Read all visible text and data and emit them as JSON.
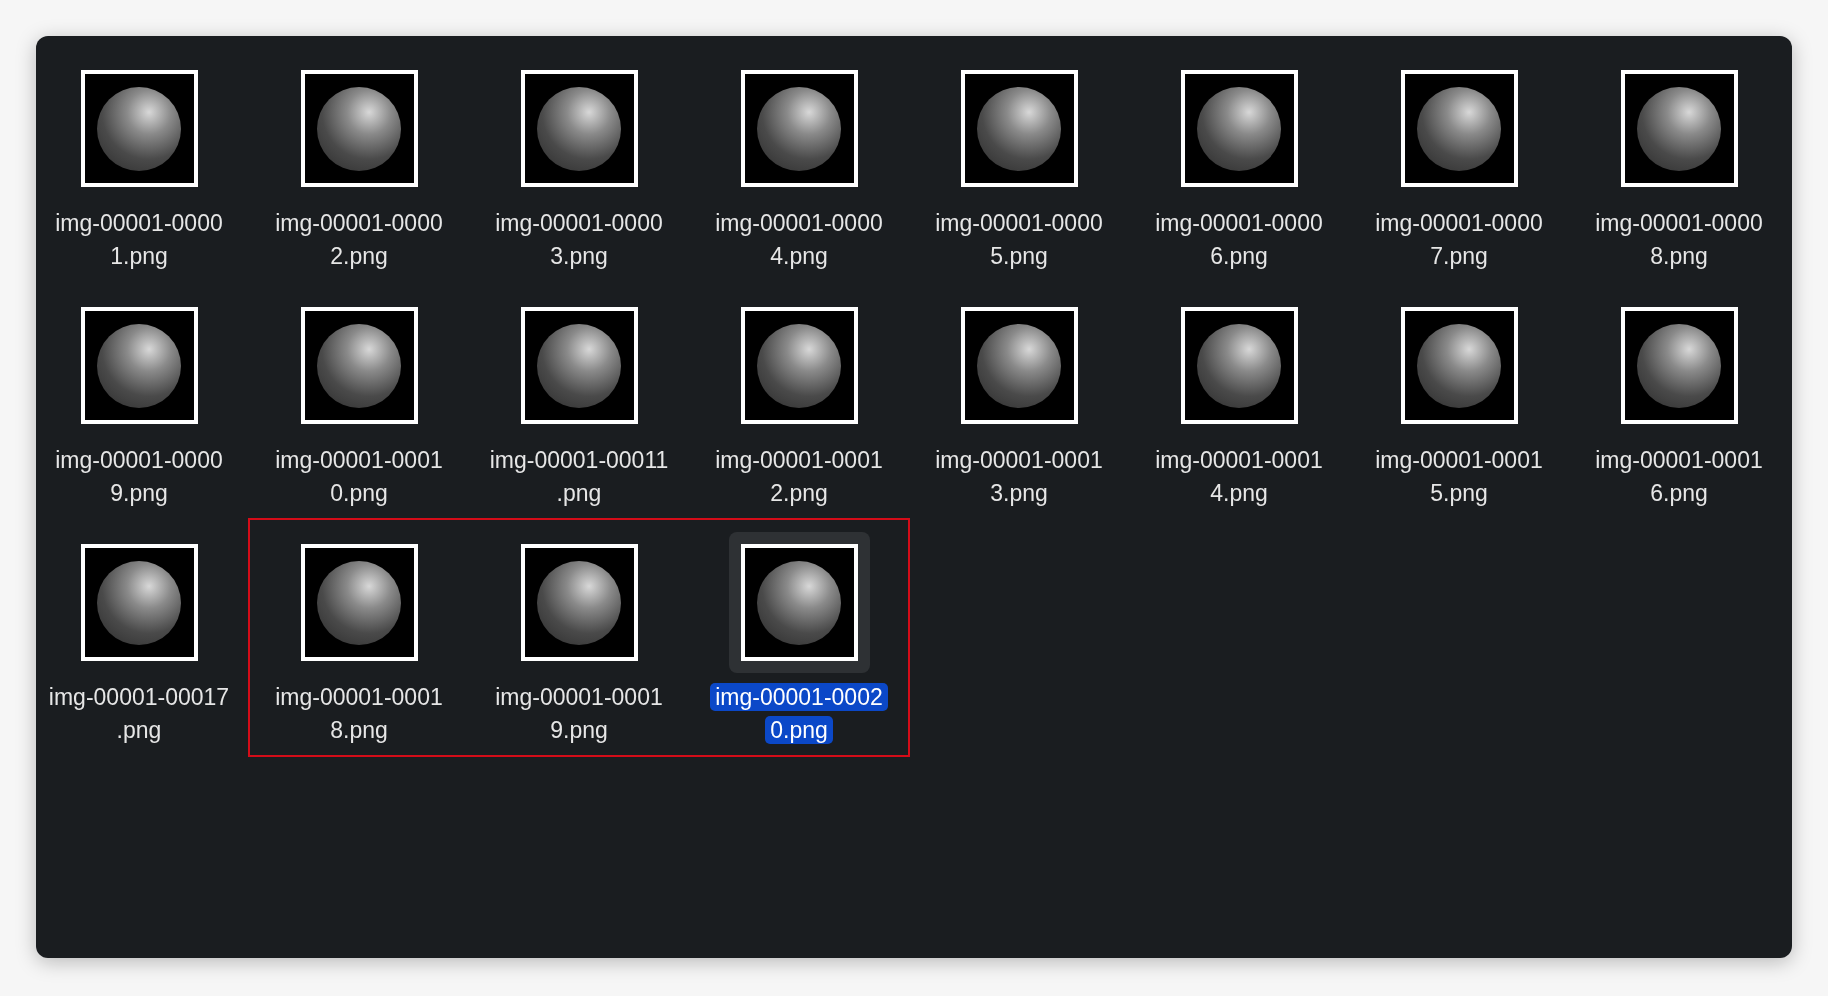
{
  "files": [
    {
      "name_lines": [
        "img-00001-0000",
        "1.png"
      ],
      "selected": false
    },
    {
      "name_lines": [
        "img-00001-0000",
        "2.png"
      ],
      "selected": false
    },
    {
      "name_lines": [
        "img-00001-0000",
        "3.png"
      ],
      "selected": false
    },
    {
      "name_lines": [
        "img-00001-0000",
        "4.png"
      ],
      "selected": false
    },
    {
      "name_lines": [
        "img-00001-0000",
        "5.png"
      ],
      "selected": false
    },
    {
      "name_lines": [
        "img-00001-0000",
        "6.png"
      ],
      "selected": false
    },
    {
      "name_lines": [
        "img-00001-0000",
        "7.png"
      ],
      "selected": false
    },
    {
      "name_lines": [
        "img-00001-0000",
        "8.png"
      ],
      "selected": false
    },
    {
      "name_lines": [
        "img-00001-0000",
        "9.png"
      ],
      "selected": false
    },
    {
      "name_lines": [
        "img-00001-0001",
        "0.png"
      ],
      "selected": false
    },
    {
      "name_lines": [
        "img-00001-00011",
        ".png"
      ],
      "selected": false
    },
    {
      "name_lines": [
        "img-00001-0001",
        "2.png"
      ],
      "selected": false
    },
    {
      "name_lines": [
        "img-00001-0001",
        "3.png"
      ],
      "selected": false
    },
    {
      "name_lines": [
        "img-00001-0001",
        "4.png"
      ],
      "selected": false
    },
    {
      "name_lines": [
        "img-00001-0001",
        "5.png"
      ],
      "selected": false
    },
    {
      "name_lines": [
        "img-00001-0001",
        "6.png"
      ],
      "selected": false
    },
    {
      "name_lines": [
        "img-00001-00017",
        ".png"
      ],
      "selected": false
    }
  ],
  "annotation": {
    "kind": "rectangle",
    "files": [
      {
        "name_lines": [
          "img-00001-0001",
          "8.png"
        ],
        "selected": false
      },
      {
        "name_lines": [
          "img-00001-0001",
          "9.png"
        ],
        "selected": false
      },
      {
        "name_lines": [
          "img-00001-0002",
          "0.png"
        ],
        "selected": true
      }
    ]
  }
}
